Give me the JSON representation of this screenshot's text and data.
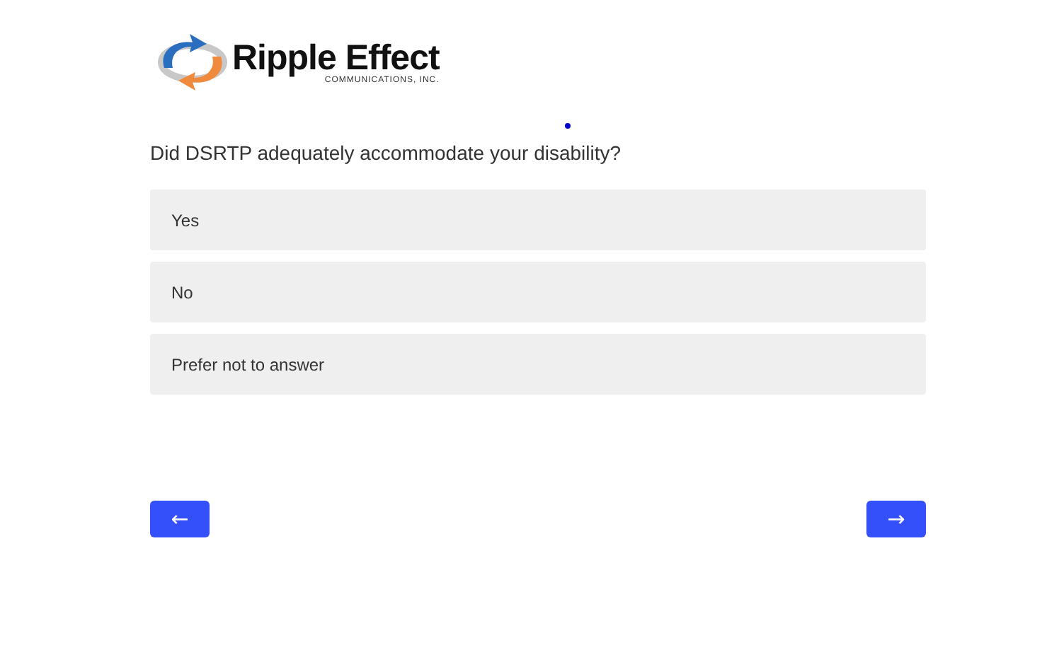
{
  "logo": {
    "name": "Ripple Effect",
    "tagline": "COMMUNICATIONS, INC."
  },
  "question": "Did DSRTP adequately accommodate your disability?",
  "options": [
    {
      "label": "Yes",
      "selected": false
    },
    {
      "label": "No",
      "selected": false
    },
    {
      "label": "Prefer not to answer",
      "selected": false
    }
  ],
  "navigation": {
    "back": "←",
    "next": "→"
  }
}
